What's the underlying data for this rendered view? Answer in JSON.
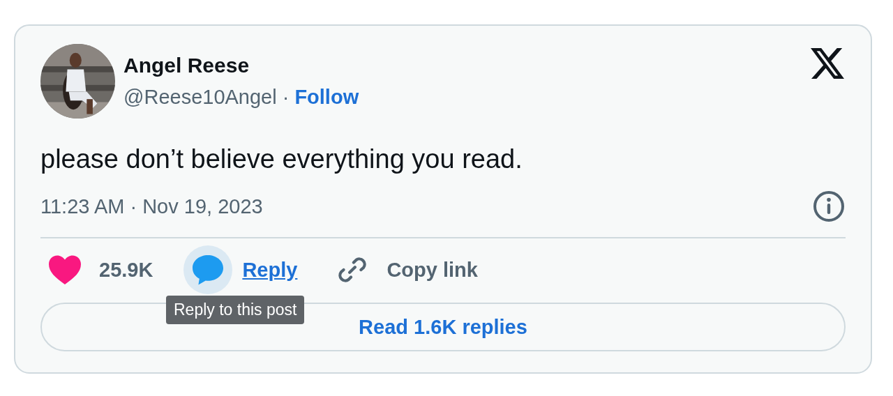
{
  "author": {
    "name": "Angel Reese",
    "handle": "@Reese10Angel",
    "separator": "·",
    "follow": "Follow"
  },
  "post": {
    "text": "please don’t believe everything you read.",
    "timestamp": "11:23 AM · Nov 19, 2023"
  },
  "actions": [
    {
      "kind": "like",
      "label": "25.9K",
      "hovered": false
    },
    {
      "kind": "reply",
      "label": "Reply",
      "hovered": true
    },
    {
      "kind": "copy",
      "label": "Copy link",
      "hovered": false
    }
  ],
  "tooltip": "Reply to this post",
  "read_replies": "Read 1.6K replies"
}
